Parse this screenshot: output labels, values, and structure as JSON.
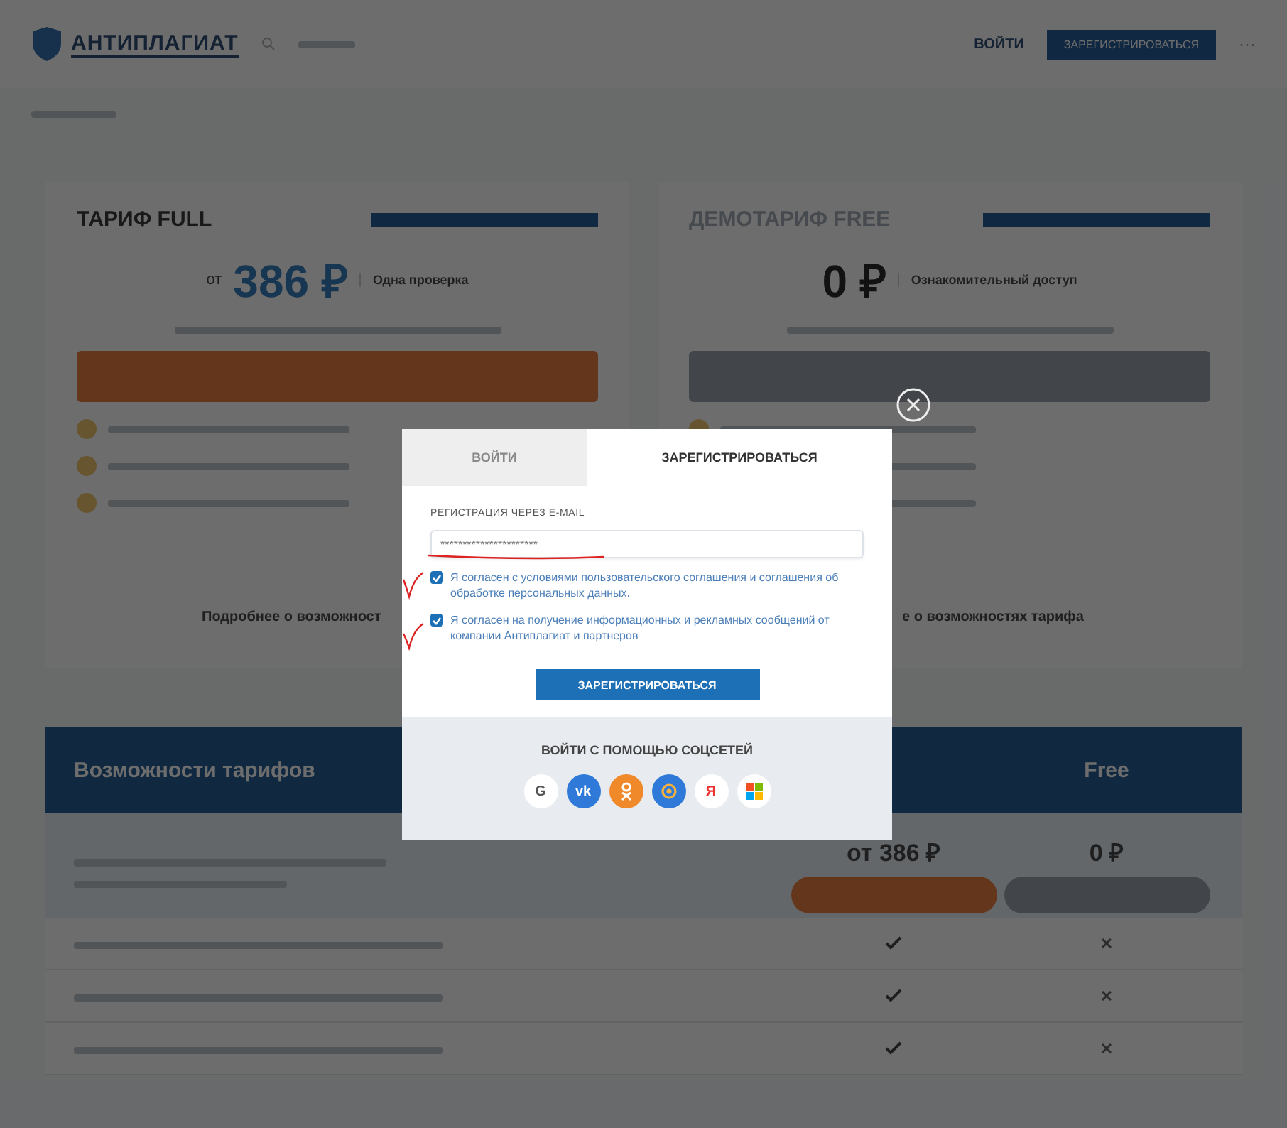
{
  "header": {
    "logo": "АНТИПЛАГИАТ",
    "login": "ВОЙТИ",
    "register": "ЗАРЕГИСТРИРОВАТЬСЯ",
    "more": "···"
  },
  "plans": [
    {
      "kind": "full",
      "title": "ТАРИФ FULL",
      "price_prefix": "от",
      "price": "386 ₽",
      "period": "Одна проверка",
      "more": "Подробнее о возможност"
    },
    {
      "kind": "free",
      "title": "ДЕМОТАРИФ FREE",
      "price": "0 ₽",
      "period": "Ознакомительный доступ",
      "more": "е о возможностях тарифа"
    }
  ],
  "table": {
    "title": "Возможности тарифов",
    "free_heading": "Free",
    "full_price": "от 386 ₽",
    "free_price": "0 ₽",
    "rows": [
      {
        "full": true,
        "free": false
      },
      {
        "full": true,
        "free": false
      },
      {
        "full": true,
        "free": false
      }
    ]
  },
  "modal": {
    "tabs": [
      {
        "label": "ВОЙТИ",
        "selected": false
      },
      {
        "label": "ЗАРЕГИСТРИРОВАТЬСЯ",
        "selected": true
      }
    ],
    "email_label": "РЕГИСТРАЦИЯ ЧЕРЕЗ E-MAIL",
    "email_value": "**********************",
    "consents": [
      {
        "text": "Я согласен с условиями пользовательского соглашения и соглашения об обработке персональных данных.",
        "checked": true
      },
      {
        "text": "Я согласен на получение информационных и рекламных сообщений от компании Антиплагиат и партнеров",
        "checked": true
      }
    ],
    "submit": "ЗАРЕГИСТРИРОВАТЬСЯ",
    "social_title": "ВОЙТИ С ПОМОЩЬЮ СОЦСЕТЕЙ",
    "socials": [
      {
        "kind": "google",
        "label": "G"
      },
      {
        "kind": "vk",
        "label": "vk"
      },
      {
        "kind": "ok"
      },
      {
        "kind": "mailru"
      },
      {
        "kind": "yandex",
        "label": "Я"
      },
      {
        "kind": "microsoft"
      }
    ]
  }
}
